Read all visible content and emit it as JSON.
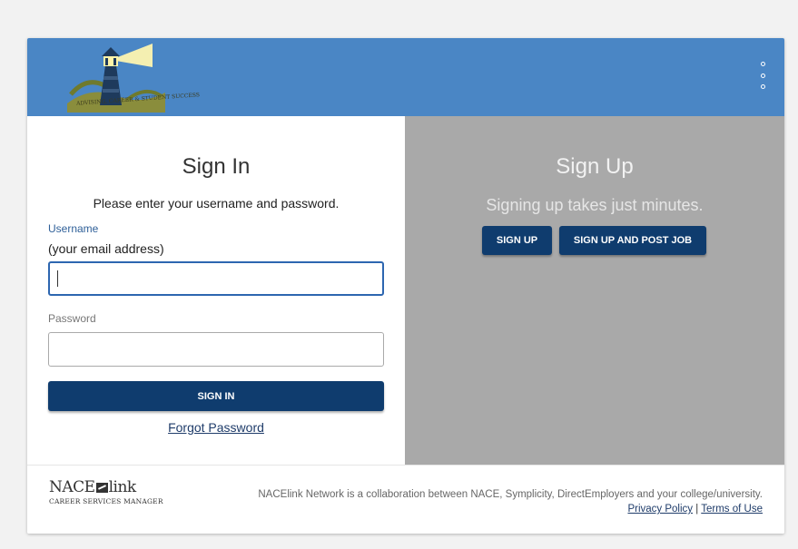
{
  "header": {
    "logo_text": "ADVISING, CAREER & STUDENT SUCCESS",
    "menu_icon": "more-vertical-icon",
    "color": "#4a86c5"
  },
  "signin": {
    "title": "Sign In",
    "subtitle": "Please enter your username and password.",
    "username_label": "Username",
    "username_hint": "(your email address)",
    "username_value": "",
    "password_label": "Password",
    "password_value": "",
    "button_label": "SIGN IN",
    "forgot_label": "Forgot Password"
  },
  "signup": {
    "title": "Sign Up",
    "subtitle": "Signing up takes just minutes.",
    "signup_button": "SIGN UP",
    "signup_post_button": "SIGN UP AND POST JOB",
    "panel_color": "#a9a9a9"
  },
  "footer": {
    "logo_main_left": "NACE",
    "logo_main_right": "link",
    "logo_sub": "CAREER SERVICES MANAGER",
    "text": "NACElink Network is a collaboration between NACE, Symplicity, DirectEmployers and your college/university.",
    "privacy_label": "Privacy Policy",
    "separator": "|",
    "terms_label": "Terms of Use"
  },
  "colors": {
    "button": "#0f3c6e",
    "link": "#1f3c6a",
    "focus": "#2d66b0"
  }
}
